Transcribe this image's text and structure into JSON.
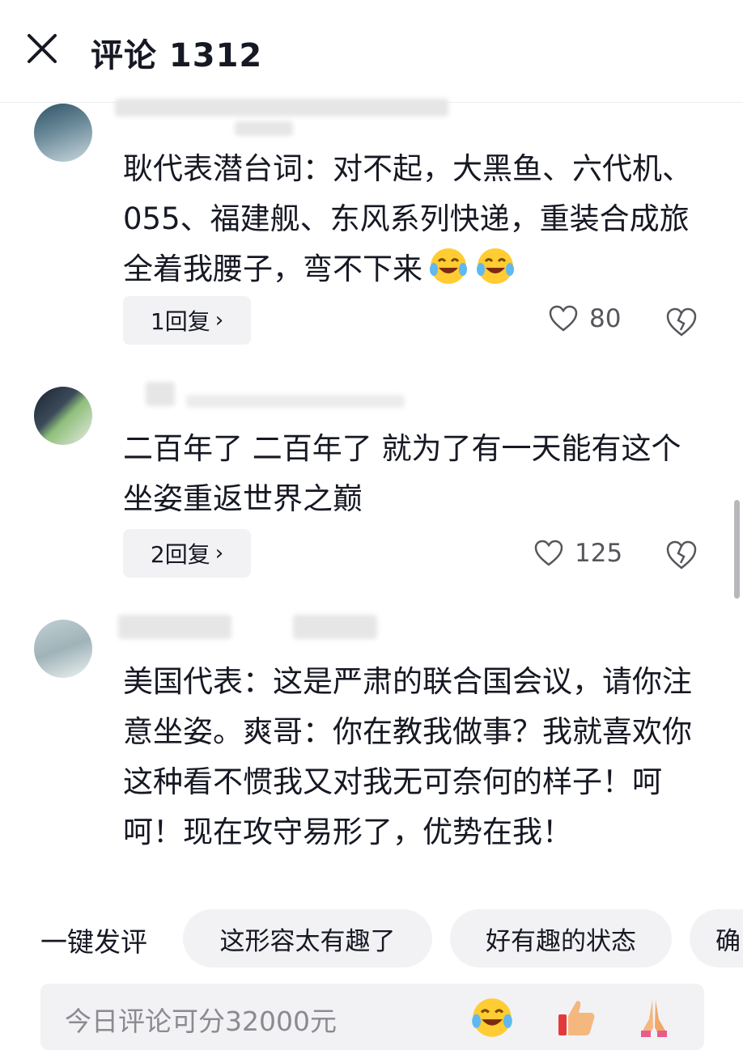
{
  "header": {
    "title": "评论 1312"
  },
  "comments": [
    {
      "text": "耿代表潜台词：对不起，大黑鱼、六代机、055、福建舰、东风系列快递，重装合成旅全着我腰子，弯不下来",
      "reply_label": "1回复",
      "likes": "80"
    },
    {
      "text": "二百年了 二百年了 就为了有一天能有这个坐姿重返世界之巅",
      "reply_label": "2回复",
      "likes": "125"
    },
    {
      "text": "美国代表：这是严肃的联合国会议，请你注意坐姿。爽哥：你在教我做事？我就喜欢你这种看不惯我又对我无可奈何的样子！呵呵！现在攻守易形了，优势在我！"
    }
  ],
  "quick_reply": {
    "label": "一键发评",
    "chips": [
      "这形容太有趣了",
      "好有趣的状态",
      "确"
    ]
  },
  "input": {
    "placeholder": "今日评论可分32000元"
  },
  "icons": {
    "close": "close-icon",
    "like": "heart-outline-icon",
    "dislike": "broken-heart-icon",
    "emoji_laugh": "laughing-crying-emoji",
    "emoji_thumbs": "thumbs-up-emoji",
    "emoji_pray": "praying-hands-emoji"
  },
  "colors": {
    "text": "#161823",
    "secondary": "#56575c",
    "chip_bg": "#f2f2f4",
    "placeholder": "#8a8b91"
  }
}
